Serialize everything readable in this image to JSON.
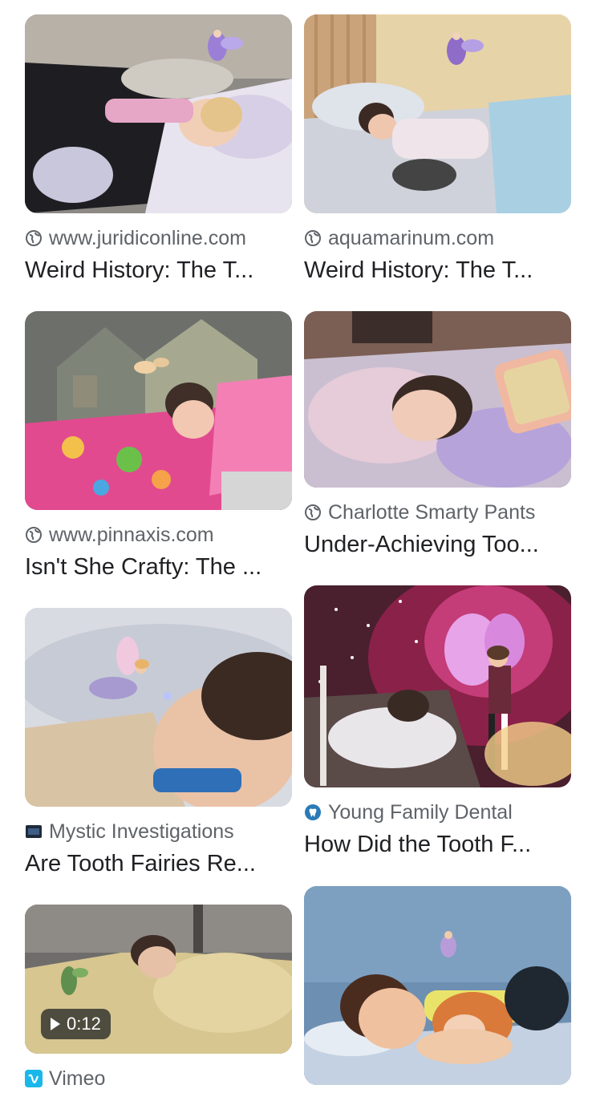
{
  "results": [
    {
      "source": "www.juridiconline.com",
      "title": "Weird History: The T...",
      "icon": "globe-icon"
    },
    {
      "source": "aquamarinum.com",
      "title": "Weird History: The T...",
      "icon": "globe-icon"
    },
    {
      "source": "www.pinnaxis.com",
      "title": "Isn't She Crafty: The ...",
      "icon": "globe-icon"
    },
    {
      "source": "Charlotte Smarty Pants",
      "title": "Under-Achieving Too...",
      "icon": "globe-icon"
    },
    {
      "source": "Mystic Investigations",
      "title": "Are Tooth Fairies Re...",
      "icon": "site-favicon-icon"
    },
    {
      "source": "Young Family Dental",
      "title": "How Did the Tooth F...",
      "icon": "tooth-favicon-icon"
    },
    {
      "source": "Vimeo",
      "title": "",
      "icon": "vimeo-icon",
      "video_duration": "0:12"
    },
    {
      "source": "",
      "title": "",
      "icon": ""
    }
  ]
}
